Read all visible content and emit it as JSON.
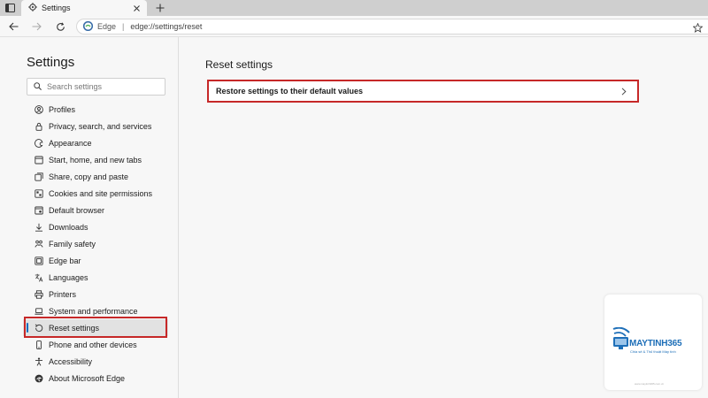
{
  "browser": {
    "tab_title": "Settings",
    "address_brand": "Edge",
    "address_separator": "|",
    "address_url": "edge://settings/reset"
  },
  "sidebar": {
    "title": "Settings",
    "search_placeholder": "Search settings",
    "items": [
      {
        "label": "Profiles",
        "icon": "profile-icon"
      },
      {
        "label": "Privacy, search, and services",
        "icon": "lock-icon"
      },
      {
        "label": "Appearance",
        "icon": "appearance-icon"
      },
      {
        "label": "Start, home, and new tabs",
        "icon": "start-icon"
      },
      {
        "label": "Share, copy and paste",
        "icon": "share-icon"
      },
      {
        "label": "Cookies and site permissions",
        "icon": "cookies-icon"
      },
      {
        "label": "Default browser",
        "icon": "default-browser-icon"
      },
      {
        "label": "Downloads",
        "icon": "download-icon"
      },
      {
        "label": "Family safety",
        "icon": "family-icon"
      },
      {
        "label": "Edge bar",
        "icon": "edge-bar-icon"
      },
      {
        "label": "Languages",
        "icon": "language-icon"
      },
      {
        "label": "Printers",
        "icon": "printer-icon"
      },
      {
        "label": "System and performance",
        "icon": "laptop-icon"
      },
      {
        "label": "Reset settings",
        "icon": "reset-icon",
        "active": true
      },
      {
        "label": "Phone and other devices",
        "icon": "phone-icon"
      },
      {
        "label": "Accessibility",
        "icon": "accessibility-icon"
      },
      {
        "label": "About Microsoft Edge",
        "icon": "edge-logo-icon"
      }
    ]
  },
  "main": {
    "title": "Reset settings",
    "restore_label": "Restore settings to their default values"
  },
  "watermark": {
    "brand": "MAYTINH365",
    "tagline": "Chia sẻ & Thủ thuật Máy tính",
    "url": "www.maytinh365.com.vn"
  },
  "colors": {
    "highlight": "#c62828",
    "accent": "#0f6cbd",
    "brand_blue": "#1e6fb8"
  }
}
